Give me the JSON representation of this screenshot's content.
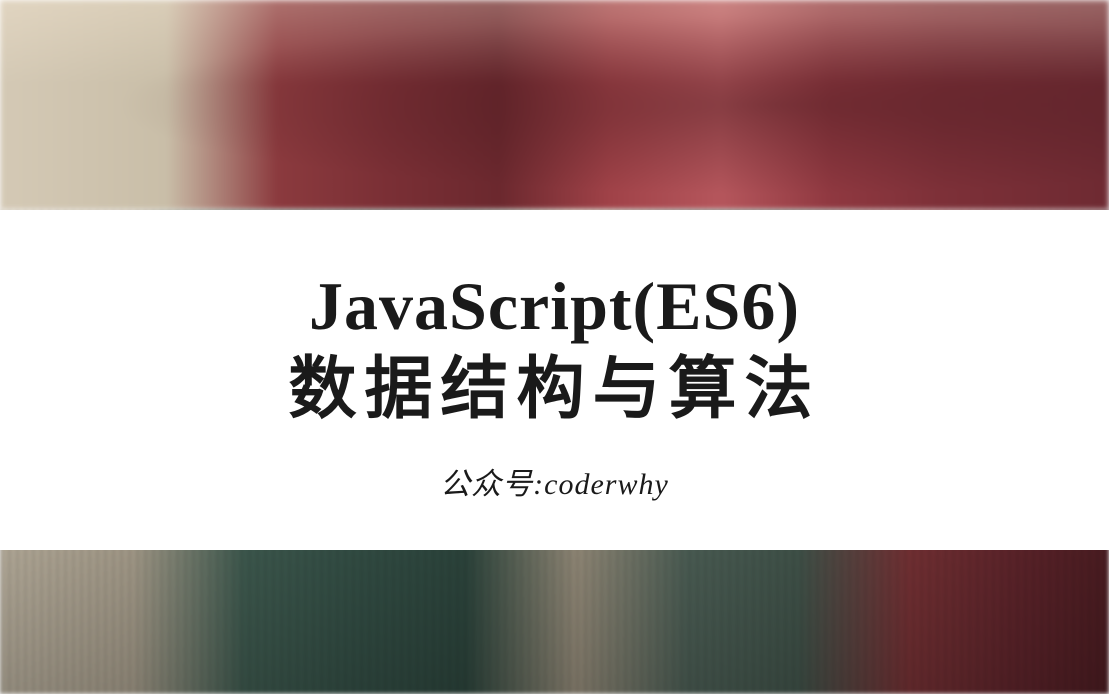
{
  "banner": {
    "title_line1": "JavaScript(ES6)",
    "title_line2": "数据结构与算法",
    "subtitle": "公众号:coderwhy"
  }
}
